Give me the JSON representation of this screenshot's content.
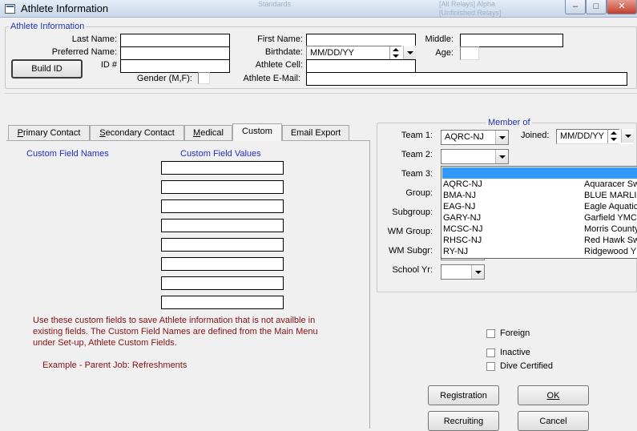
{
  "window": {
    "title": "Athlete Information",
    "controls": {
      "minimize": "–",
      "maximize": "□",
      "close": "✕"
    },
    "background_ghost_text": [
      "Standards",
      "[All Relays] Alpha",
      "[Unfinished Relays]"
    ]
  },
  "athlete_group": {
    "legend": "Athlete Information",
    "last_name": {
      "label": "Last Name:",
      "value": ""
    },
    "preferred_name": {
      "label": "Preferred Name:",
      "value": ""
    },
    "id": {
      "label": "ID #",
      "value": ""
    },
    "build_id_button": "Build ID",
    "gender": {
      "label": "Gender (M,F):",
      "value": ""
    },
    "first_name": {
      "label": "First Name:",
      "value": ""
    },
    "birthdate": {
      "label": "Birthdate:",
      "value": "MM/DD/YY"
    },
    "athlete_cell": {
      "label": "Athlete Cell:",
      "value": ""
    },
    "athlete_email": {
      "label": "Athlete E-Mail:",
      "value": ""
    },
    "middle": {
      "label": "Middle:",
      "value": ""
    },
    "age": {
      "label": "Age:",
      "value": ""
    }
  },
  "tabs": [
    {
      "label": "Primary Contact",
      "underline": "P",
      "rest": "rimary Contact"
    },
    {
      "label": "Secondary Contact",
      "underline": "S",
      "rest": "econdary Contact"
    },
    {
      "label": "Medical",
      "underline": "M",
      "rest": "edical"
    },
    {
      "label": "Custom",
      "underline": "",
      "rest": "Custom",
      "active": true
    },
    {
      "label": "Email Export",
      "underline": "",
      "rest": "Email Export"
    }
  ],
  "custom_tab": {
    "names_header": "Custom Field Names",
    "values_header": "Custom Field Values",
    "values": [
      "",
      "",
      "",
      "",
      "",
      "",
      "",
      ""
    ],
    "help_text": [
      "Use these custom fields to save Athlete information that is not availble in",
      "existing fields.  The Custom Field Names are defined from the  Main Menu",
      "under Set-up, Athlete Custom Fields."
    ],
    "example_text": "Example - Parent Job: Refreshments"
  },
  "member_of": {
    "legend": "Member of",
    "team1": {
      "label": "Team 1:",
      "value": "AQRC-NJ"
    },
    "joined": {
      "label": "Joined:",
      "value": "MM/DD/YY"
    },
    "team2": {
      "label": "Team 2:",
      "value": ""
    },
    "team3": {
      "label": "Team 3:",
      "value": ""
    },
    "group": {
      "label": "Group:"
    },
    "subgroup": {
      "label": "Subgroup:"
    },
    "wm_group": {
      "label": "WM Group:"
    },
    "wm_subgr": {
      "label": "WM Subgr:"
    },
    "school_yr": {
      "label": "School Yr:",
      "value": ""
    },
    "team_dropdown_options": [
      {
        "code": "AQRC-NJ",
        "name": "Aquaracer Sw"
      },
      {
        "code": "BMA-NJ",
        "name": "BLUE MARLIN"
      },
      {
        "code": "EAG-NJ",
        "name": "Eagle Aquatic"
      },
      {
        "code": "GARY-NJ",
        "name": "Garfield YMCA"
      },
      {
        "code": "MCSC-NJ",
        "name": "Morris County"
      },
      {
        "code": "RHSC-NJ",
        "name": "Red Hawk Sw"
      },
      {
        "code": "RY-NJ",
        "name": "Ridgewood Y"
      }
    ]
  },
  "checkboxes": {
    "foreign": {
      "label": "Foreign",
      "checked": false
    },
    "inactive": {
      "label": "Inactive",
      "checked": false
    },
    "dive_certified": {
      "label": "Dive Certified",
      "checked": false
    }
  },
  "buttons": {
    "registration": "Registration",
    "ok": "OK",
    "recruiting": "Recruiting",
    "cancel": "Cancel"
  },
  "colors": {
    "legend_blue": "#2233aa",
    "custom_header_blue": "#1d2ec8",
    "help_text_maroon": "#8a0f12",
    "dropdown_highlight": "#3399ff"
  }
}
